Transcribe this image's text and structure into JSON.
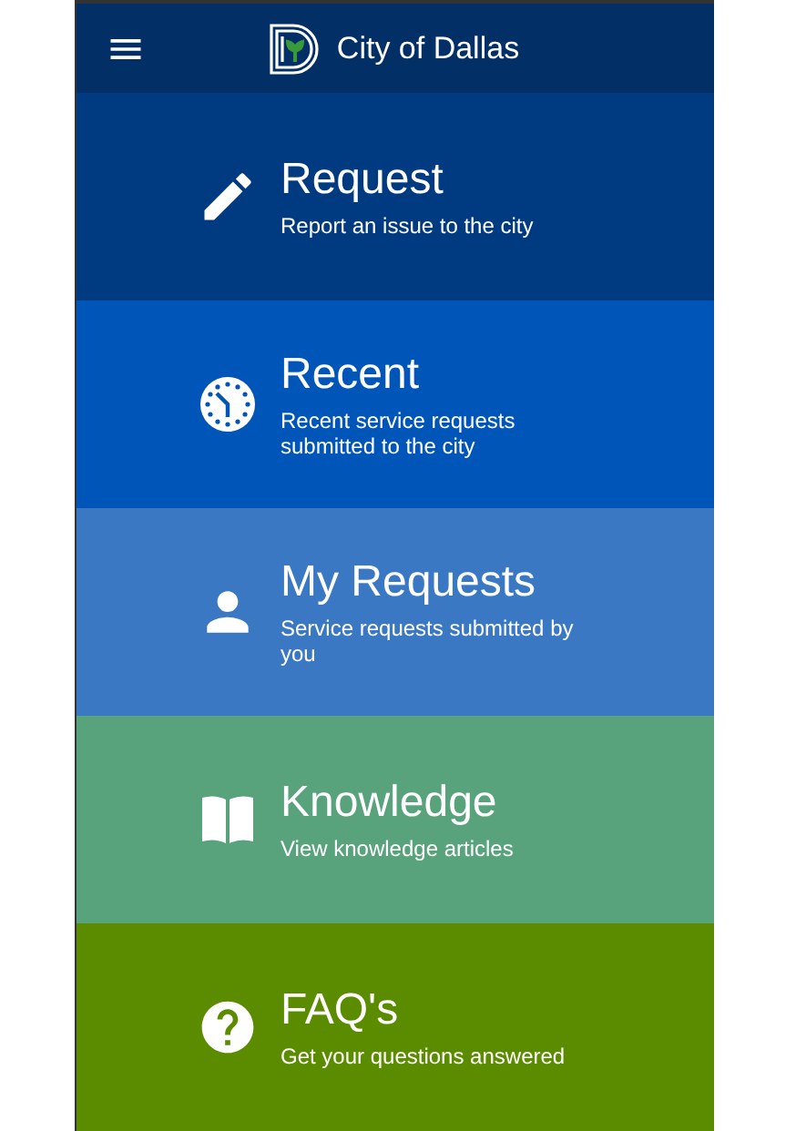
{
  "header": {
    "title": "City of Dallas"
  },
  "tiles": [
    {
      "kind": "pencil",
      "title": "Request",
      "subtitle": "Report an issue to the city",
      "color": "#003a80"
    },
    {
      "kind": "clock",
      "title": "Recent",
      "subtitle": "Recent service requests submitted to the city",
      "color": "#0055b8"
    },
    {
      "kind": "person",
      "title": "My Requests",
      "subtitle": "Service requests submitted by you",
      "color": "#3b78c4"
    },
    {
      "kind": "book",
      "title": "Knowledge",
      "subtitle": "View knowledge articles",
      "color": "#58a27c"
    },
    {
      "kind": "help",
      "title": "FAQ's",
      "subtitle": "Get your questions answered",
      "color": "#5b8c00"
    }
  ]
}
